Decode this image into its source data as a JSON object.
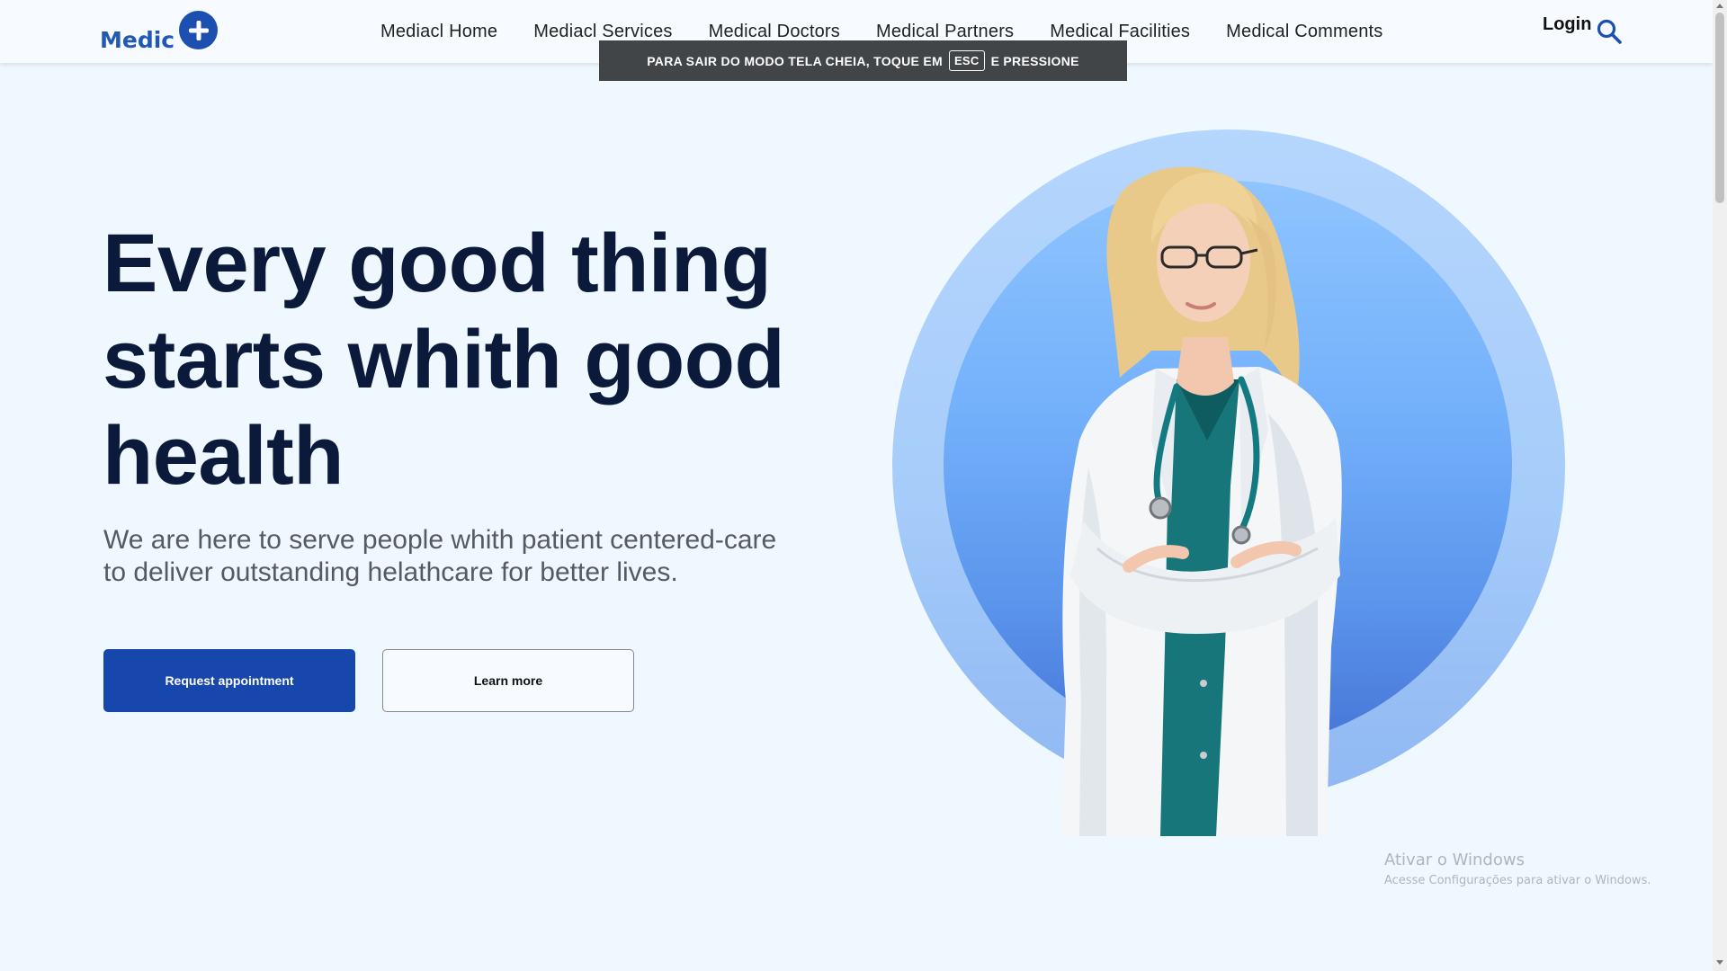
{
  "brand": {
    "name": "Medic",
    "logo_icon": "plus-circle-icon",
    "color": "#2157b6"
  },
  "nav": {
    "items": [
      {
        "label": "Mediacl Home"
      },
      {
        "label": "Mediacl Services"
      },
      {
        "label": "Medical Doctors"
      },
      {
        "label": "Medical Partners"
      },
      {
        "label": "Medical Facilities"
      },
      {
        "label": "Medical Comments"
      }
    ]
  },
  "header": {
    "login_label": "Login",
    "search_icon": "search-icon"
  },
  "fullscreen_toast": {
    "before": "PARA SAIR DO MODO TELA CHEIA, TOQUE EM",
    "key": "ESC",
    "after": "E PRESSIONE"
  },
  "hero": {
    "headline_line1": "Every good thing",
    "headline_line2": "starts whith good",
    "headline_line3": "health",
    "subtext_line1": "We are here to serve people whith patient centered-care",
    "subtext_line2": "to deliver outstanding helathcare for better lives.",
    "primary_button": "Request appointment",
    "secondary_button": "Learn more",
    "accent_color": "#1747ad",
    "headline_color": "#0b1a3a"
  },
  "watermark": {
    "title": "Ativar o Windows",
    "subtitle": "Acesse Configurações para ativar o Windows."
  }
}
